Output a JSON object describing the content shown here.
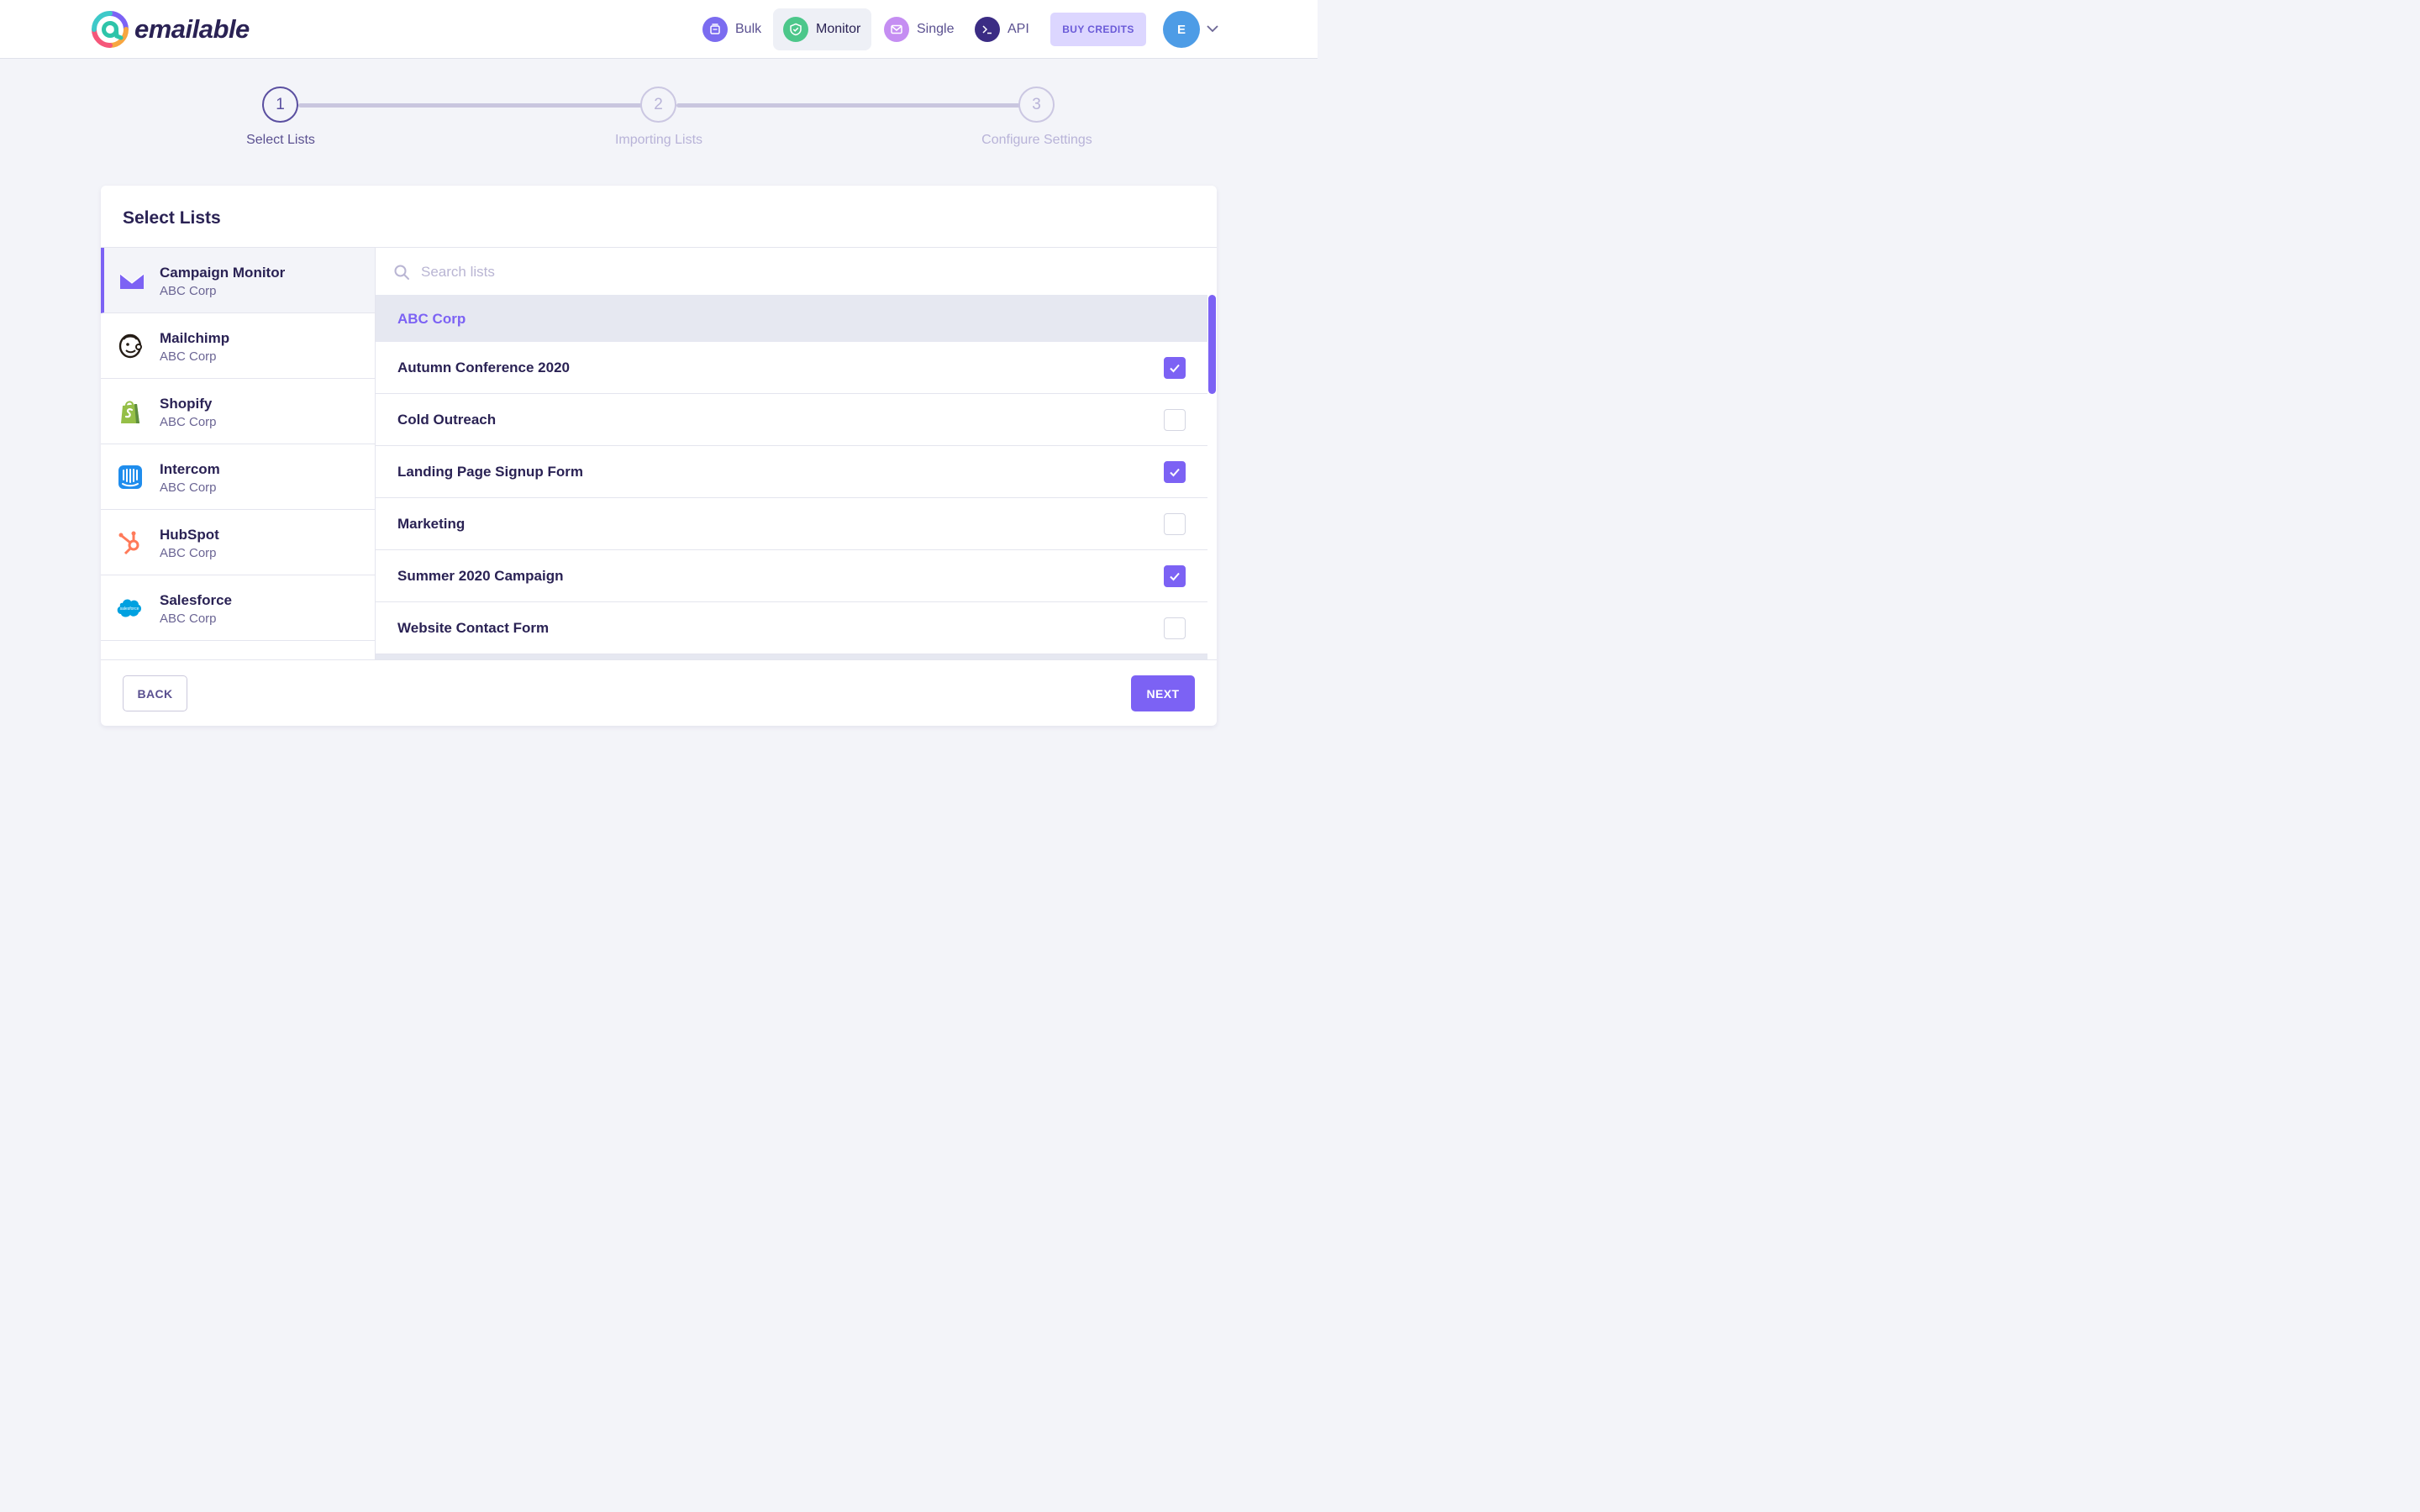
{
  "brand": {
    "name": "emailable"
  },
  "nav": {
    "items": [
      {
        "label": "Bulk",
        "icon": "bulk-icon",
        "color": "#7b6cf0"
      },
      {
        "label": "Monitor",
        "icon": "shield-icon",
        "color": "#4cc78a",
        "active": true
      },
      {
        "label": "Single",
        "icon": "envelope-icon",
        "color": "#c58ef2"
      },
      {
        "label": "API",
        "icon": "terminal-icon",
        "color": "#3b2c84"
      }
    ],
    "buy_credits": "BUY CREDITS",
    "avatar_initial": "E"
  },
  "stepper": {
    "steps": [
      {
        "number": "1",
        "label": "Select Lists",
        "state": "active"
      },
      {
        "number": "2",
        "label": "Importing Lists",
        "state": "pending"
      },
      {
        "number": "3",
        "label": "Configure Settings",
        "state": "pending"
      }
    ]
  },
  "card": {
    "title": "Select Lists",
    "providers": [
      {
        "name": "Campaign Monitor",
        "account": "ABC Corp",
        "icon": "campaign-monitor-icon",
        "active": true
      },
      {
        "name": "Mailchimp",
        "account": "ABC Corp",
        "icon": "mailchimp-icon"
      },
      {
        "name": "Shopify",
        "account": "ABC Corp",
        "icon": "shopify-icon"
      },
      {
        "name": "Intercom",
        "account": "ABC Corp",
        "icon": "intercom-icon"
      },
      {
        "name": "HubSpot",
        "account": "ABC Corp",
        "icon": "hubspot-icon"
      },
      {
        "name": "Salesforce",
        "account": "ABC Corp",
        "icon": "salesforce-icon",
        "logo_text": "salesforce"
      }
    ],
    "search": {
      "placeholder": "Search lists",
      "value": ""
    },
    "group": "ABC Corp",
    "lists": [
      {
        "name": "Autumn Conference 2020",
        "checked": true
      },
      {
        "name": "Cold Outreach",
        "checked": false
      },
      {
        "name": "Landing Page Signup Form",
        "checked": true
      },
      {
        "name": "Marketing",
        "checked": false
      },
      {
        "name": "Summer 2020 Campaign",
        "checked": true
      },
      {
        "name": "Website Contact Form",
        "checked": false
      }
    ],
    "back": "BACK",
    "next": "NEXT"
  },
  "colors": {
    "accent": "#7c62f4",
    "text": "#2a2254",
    "background": "#f3f4f9"
  }
}
